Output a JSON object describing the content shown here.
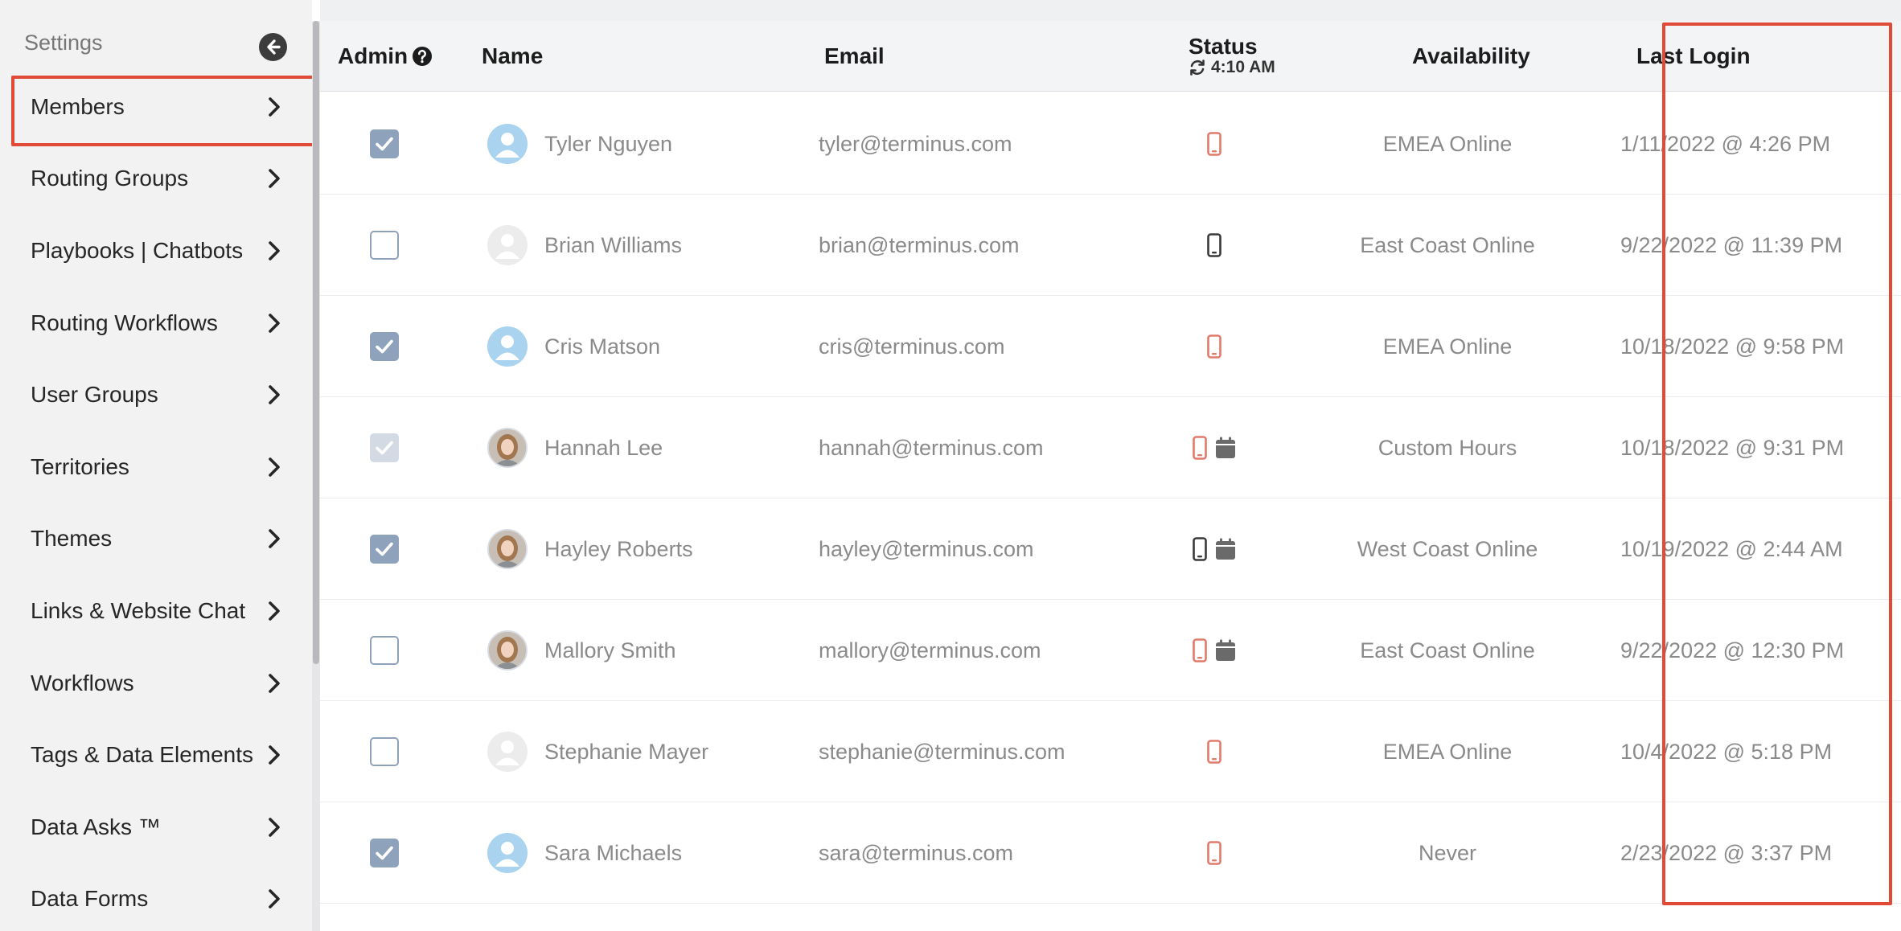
{
  "sidebar": {
    "title": "Settings",
    "items": [
      {
        "label": "Members",
        "active": true
      },
      {
        "label": "Routing Groups"
      },
      {
        "label": "Playbooks | Chatbots"
      },
      {
        "label": "Routing Workflows"
      },
      {
        "label": "User Groups"
      },
      {
        "label": "Territories"
      },
      {
        "label": "Themes"
      },
      {
        "label": "Links & Website Chat"
      },
      {
        "label": "Workflows"
      },
      {
        "label": "Tags & Data Elements"
      },
      {
        "label": "Data Asks ™"
      },
      {
        "label": "Data Forms"
      }
    ]
  },
  "table": {
    "headers": {
      "admin": "Admin",
      "name": "Name",
      "email": "Email",
      "status": "Status",
      "status_time": "4:10 AM",
      "availability": "Availability",
      "last_login": "Last Login"
    },
    "rows": [
      {
        "admin": "checked",
        "avatar": "default-blue",
        "name": "Tyler Nguyen",
        "email": "tyler@terminus.com",
        "status_icons": [
          "phone-red"
        ],
        "availability": "EMEA Online",
        "last_login": "1/11/2022 @ 4:26 PM"
      },
      {
        "admin": "unchecked",
        "avatar": "default-gray",
        "name": "Brian Williams",
        "email": "brian@terminus.com",
        "status_icons": [
          "phone-dark"
        ],
        "availability": "East Coast Online",
        "last_login": "9/22/2022 @ 11:39 PM"
      },
      {
        "admin": "checked",
        "avatar": "default-blue",
        "name": "Cris Matson",
        "email": "cris@terminus.com",
        "status_icons": [
          "phone-red"
        ],
        "availability": "EMEA Online",
        "last_login": "10/18/2022 @ 9:58 PM"
      },
      {
        "admin": "checked-disabled",
        "avatar": "photo",
        "name": "Hannah Lee",
        "email": "hannah@terminus.com",
        "status_icons": [
          "phone-red",
          "calendar"
        ],
        "availability": "Custom Hours",
        "last_login": "10/18/2022 @ 9:31 PM"
      },
      {
        "admin": "checked",
        "avatar": "photo",
        "name": "Hayley Roberts",
        "email": "hayley@terminus.com",
        "status_icons": [
          "phone-dark",
          "calendar"
        ],
        "availability": "West Coast Online",
        "last_login": "10/19/2022 @ 2:44 AM"
      },
      {
        "admin": "unchecked",
        "avatar": "photo",
        "name": "Mallory Smith",
        "email": "mallory@terminus.com",
        "status_icons": [
          "phone-red",
          "calendar"
        ],
        "availability": "East Coast Online",
        "last_login": "9/22/2022 @ 12:30 PM"
      },
      {
        "admin": "unchecked",
        "avatar": "default-gray",
        "name": "Stephanie Mayer",
        "email": "stephanie@terminus.com",
        "status_icons": [
          "phone-red"
        ],
        "availability": "EMEA Online",
        "last_login": "10/4/2022 @ 5:18 PM"
      },
      {
        "admin": "checked",
        "avatar": "default-blue",
        "name": "Sara Michaels",
        "email": "sara@terminus.com",
        "status_icons": [
          "phone-red"
        ],
        "availability": "Never",
        "last_login": "2/23/2022 @ 3:37 PM"
      }
    ]
  },
  "colors": {
    "highlight": "#e04a36",
    "checkbox": "#8ea2bb",
    "phone_red": "#e27a6c",
    "phone_dark": "#3a3a3a",
    "calendar": "#6a6a6a"
  }
}
